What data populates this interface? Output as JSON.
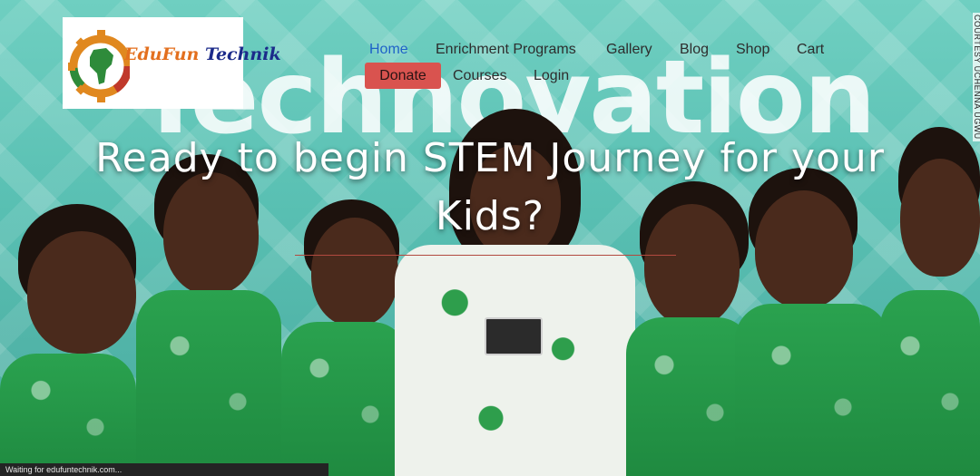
{
  "logo": {
    "part1": "EduFun",
    "part2": " Technik"
  },
  "hero": {
    "background_word": "Technovation"
  },
  "nav": {
    "items": [
      {
        "label": "Home"
      },
      {
        "label": "Enrichment Programs"
      },
      {
        "label": "Gallery"
      },
      {
        "label": "Blog"
      },
      {
        "label": "Shop"
      },
      {
        "label": "Cart"
      },
      {
        "label": "Donate"
      },
      {
        "label": "Courses"
      },
      {
        "label": "Login"
      }
    ]
  },
  "headline": {
    "line1": "Ready to begin STEM Journey for your",
    "line2": "Kids?"
  },
  "credit": "COURTESY UCHENNA UGWU",
  "status": "Waiting for edufuntechnik.com...",
  "colors": {
    "active_link": "#1e62c8",
    "donate_bg": "#d9534f",
    "rule": "#b2493f"
  }
}
